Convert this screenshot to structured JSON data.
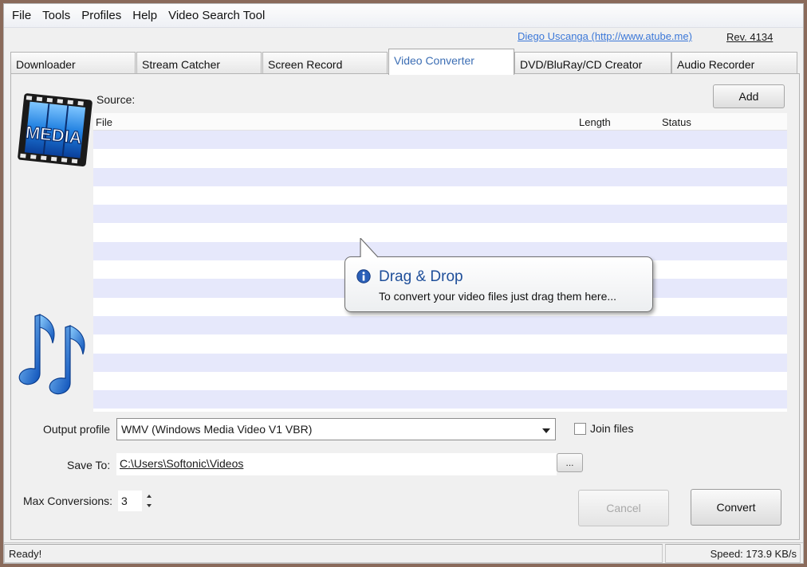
{
  "menu": [
    "File",
    "Tools",
    "Profiles",
    "Help",
    "Video Search Tool"
  ],
  "credit": {
    "author_link": "Diego Uscanga (http://www.atube.me)",
    "revision": "Rev. 4134"
  },
  "tabs": [
    {
      "label": "Downloader",
      "active": false
    },
    {
      "label": "Stream Catcher",
      "active": false
    },
    {
      "label": "Screen Record",
      "active": false
    },
    {
      "label": "Video Converter",
      "active": true
    },
    {
      "label": "DVD/BluRay/CD Creator",
      "active": false
    },
    {
      "label": "Audio Recorder",
      "active": false
    }
  ],
  "converter": {
    "logo_text": "MEDIA",
    "source_label": "Source:",
    "add_label": "Add",
    "columns": [
      "File",
      "Length",
      "Status"
    ],
    "rows": 15,
    "tooltip": {
      "title": "Drag & Drop",
      "body": "To convert your video files just drag them here..."
    },
    "output_profile_label": "Output profile",
    "output_profile_value": "WMV (Windows Media Video V1 VBR)",
    "join_files_label": "Join files",
    "join_files_checked": false,
    "save_to_label": "Save To:",
    "save_to_value": "C:\\Users\\Softonic\\Videos",
    "browse_label": "...",
    "max_conversions_label": "Max Conversions:",
    "max_conversions_value": "3",
    "cancel_label": "Cancel",
    "convert_label": "Convert"
  },
  "status": {
    "left": "Ready!",
    "right": "Speed: 173.9 KB/s"
  },
  "colors": {
    "row_alt": "#e6e8fb",
    "link": "#3c78d8",
    "active_tab_text": "#3c6eb4",
    "tooltip_title": "#1f4f9a"
  },
  "icons": {
    "logo": "media-film-logo-icon",
    "music": "music-notes-icon",
    "info": "info-icon",
    "dropdown": "chevron-down-icon",
    "spinner_up": "spinner-up-icon",
    "spinner_down": "spinner-down-icon"
  }
}
